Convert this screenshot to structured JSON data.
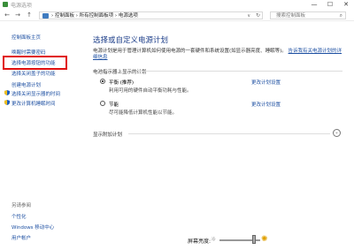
{
  "window": {
    "title": "电源选项",
    "minimize": "—",
    "maximize": "☐",
    "close": "✕"
  },
  "nav": {
    "back": "←",
    "forward": "→",
    "up": "↑"
  },
  "address": {
    "crumbs": "›  控制面板  ›  所有控制面板项  ›  电源选项",
    "dropdown": "∨",
    "refresh": "↻"
  },
  "search": {
    "placeholder": "搜索控制面板",
    "icon": "search-icon"
  },
  "sidebar": {
    "home": "控制面板主页",
    "items": [
      {
        "label": "唤醒时需要密码"
      },
      {
        "label": "选择电源按钮的功能"
      },
      {
        "label": "选择关闭盖子的功能"
      },
      {
        "label": "创建电源计划"
      },
      {
        "label": "选择关闭显示器的时间"
      },
      {
        "label": "更改计算机睡眠时间"
      }
    ],
    "see_also_title": "另请参阅",
    "see_also": [
      {
        "label": "个性化"
      },
      {
        "label": "Windows 移动中心"
      },
      {
        "label": "用户帐户"
      }
    ]
  },
  "main": {
    "title": "选择或自定义电源计划",
    "intro": "电源计划是用于管理计算机如何使用电源的一套硬件和系统设置(如显示器亮度、睡眠等)。",
    "intro_link": "告诉我有关电源计划的详细信息",
    "section_header": "电池指示器上显示的计划",
    "plans": [
      {
        "name": "平衡 (推荐)",
        "desc": "利用可用的硬件自动平衡功耗与性能。",
        "selected": true,
        "change": "更改计划设置"
      },
      {
        "name": "节能",
        "desc": "尽可能降低计算机性能以节能。",
        "selected": false,
        "change": "更改计划设置"
      }
    ],
    "extra_header": "显示附加计划",
    "expander": "⌄"
  },
  "bottom": {
    "brightness_label": "屏幕亮度:",
    "brightness_level": 0.85
  },
  "colors": {
    "link": "#1e50a2",
    "title": "#1e3f8a",
    "highlight": "#e01010"
  }
}
